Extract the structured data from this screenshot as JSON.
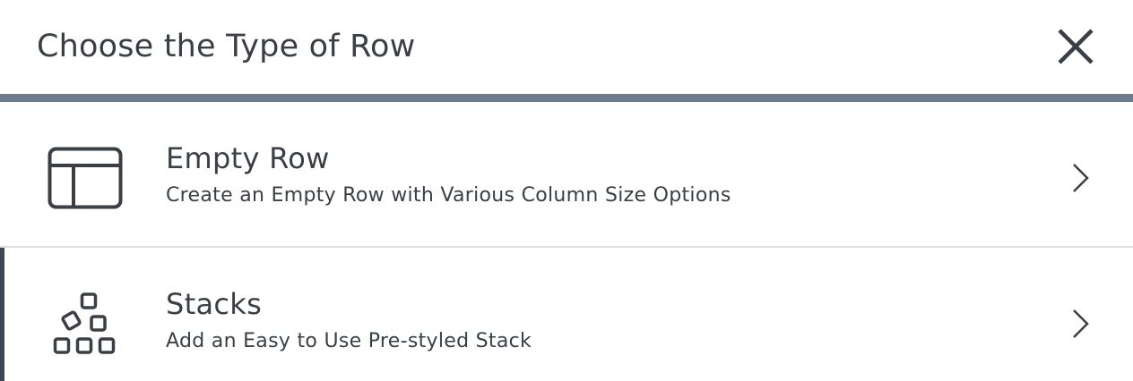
{
  "dialog": {
    "title": "Choose the Type of Row",
    "close_icon": "close-icon"
  },
  "options": [
    {
      "title": "Empty Row",
      "description": "Create an Empty Row with Various Column Size Options",
      "icon": "layout-icon",
      "chevron_icon": "chevron-right-icon"
    },
    {
      "title": "Stacks",
      "description": "Add an Easy to Use Pre-styled Stack",
      "icon": "blocks-icon",
      "chevron_icon": "chevron-right-icon",
      "selected": true
    }
  ],
  "colors": {
    "text": "#3a3f45",
    "header_bar": "#6c7a8d",
    "divider": "#dcdfe3",
    "selected_accent": "#3e4753",
    "background": "#ffffff"
  }
}
